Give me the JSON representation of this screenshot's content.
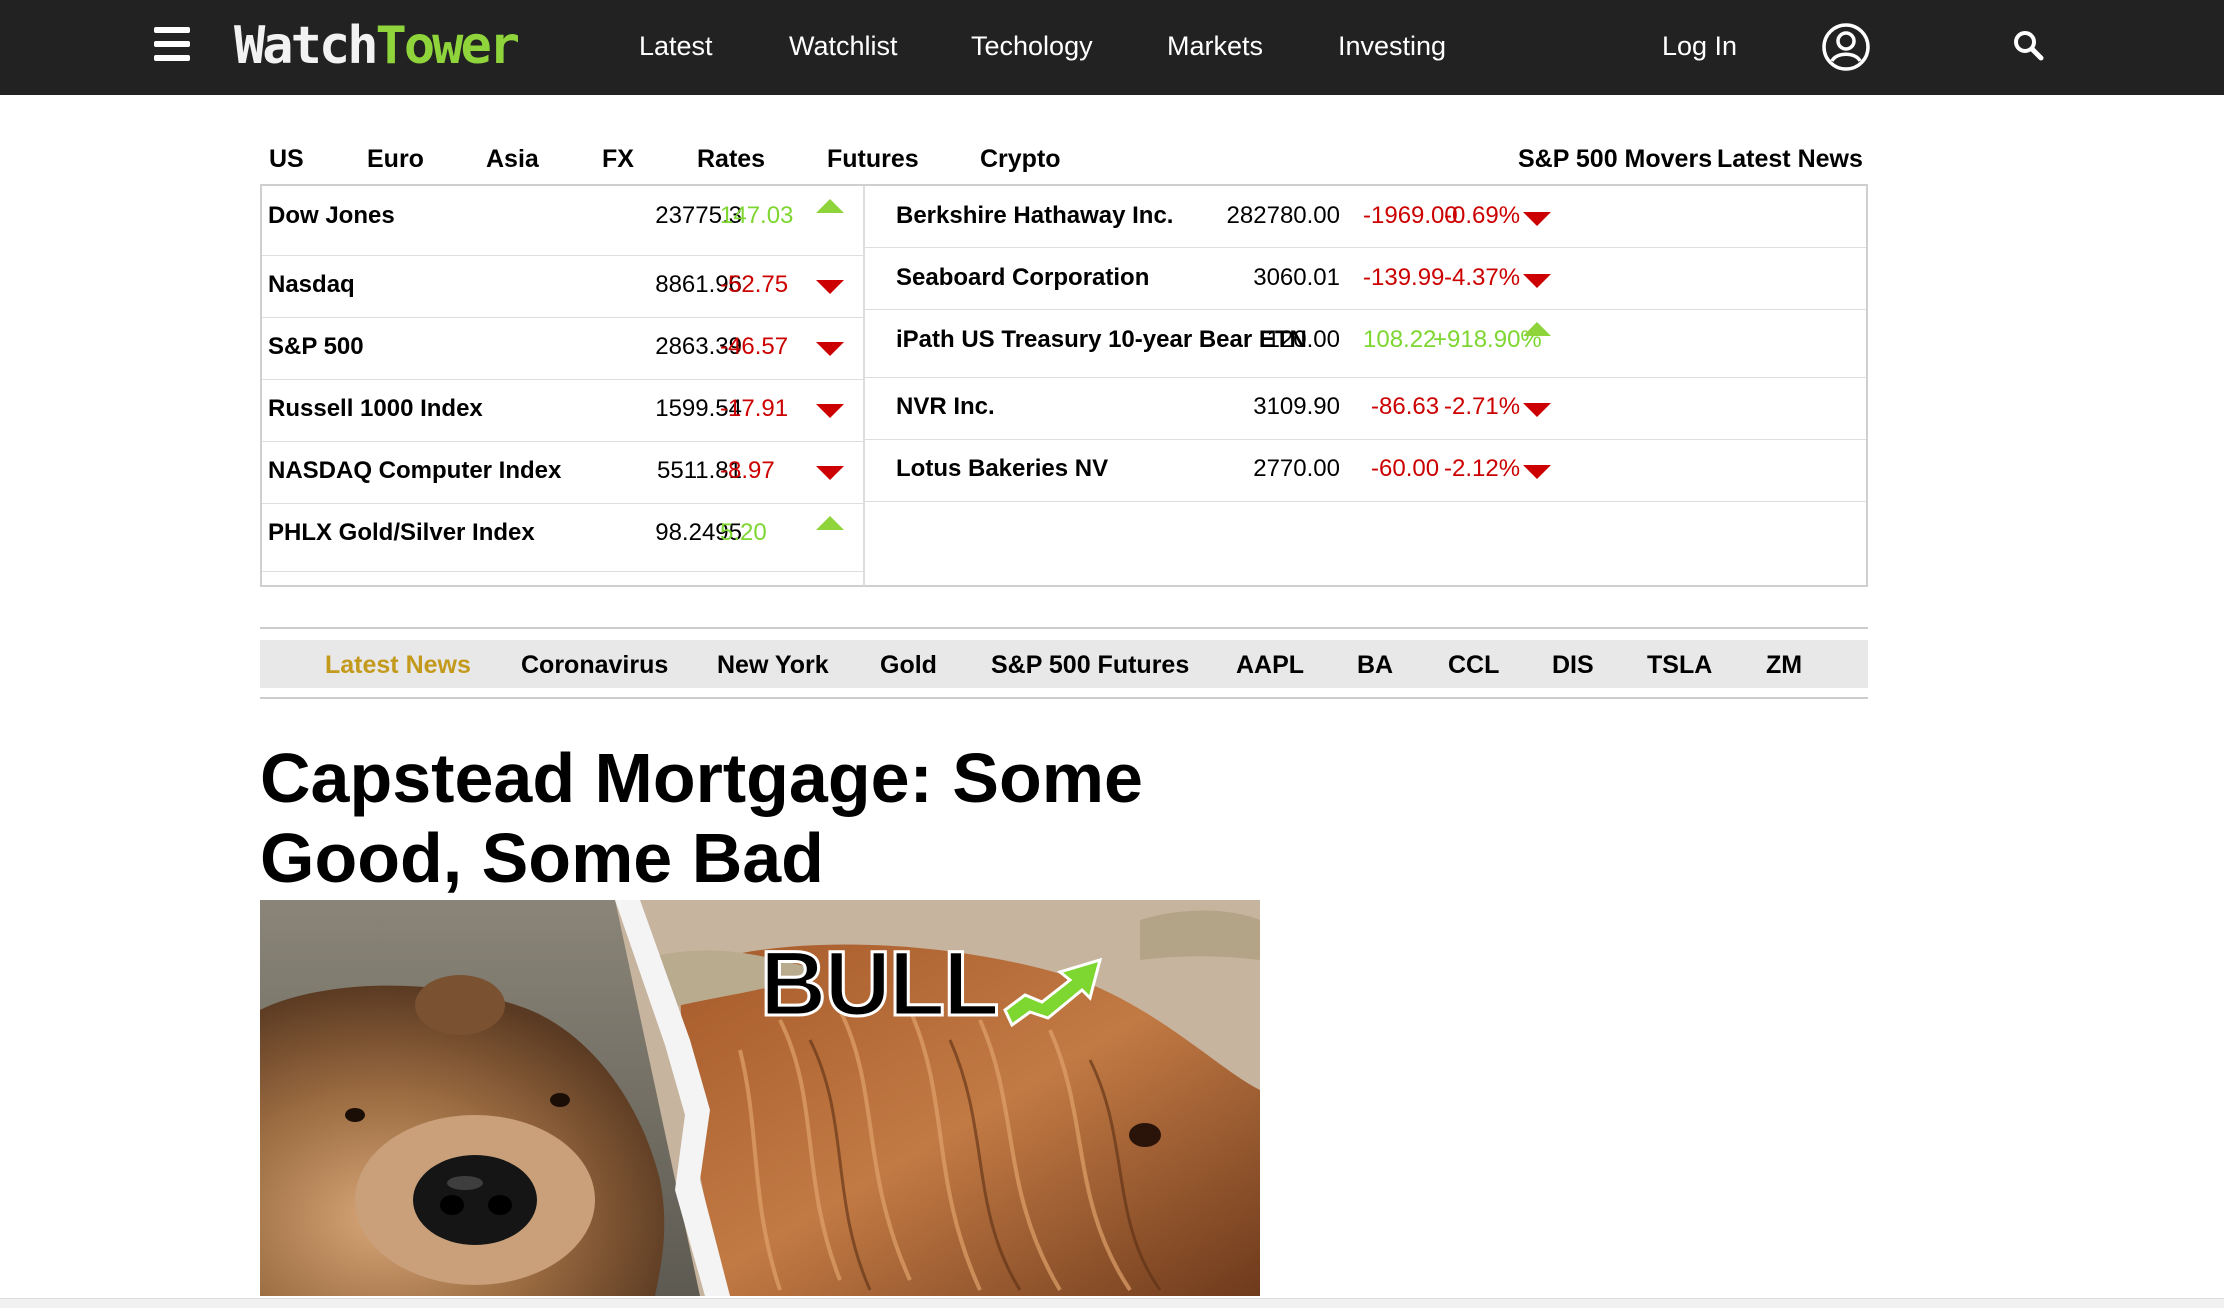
{
  "navbar": {
    "logo_part1": "Watch",
    "logo_part2": "Tower",
    "links": [
      "Latest",
      "Watchlist",
      "Techology",
      "Markets",
      "Investing"
    ],
    "login": "Log In",
    "colors": {
      "background": "#222222",
      "logo_accent": "#8ed43a"
    },
    "icons": [
      "menu-icon",
      "user-icon",
      "search-icon"
    ]
  },
  "market_tabs": {
    "left": [
      "US",
      "Euro",
      "Asia",
      "FX",
      "Rates",
      "Futures",
      "Crypto"
    ],
    "right": [
      "S&P 500 Movers",
      "Latest News"
    ]
  },
  "indices": [
    {
      "name": "Dow Jones",
      "value": "23775.3",
      "change": "147.03",
      "direction": "up"
    },
    {
      "name": "Nasdaq",
      "value": "8861.96",
      "change": "-52.75",
      "direction": "down"
    },
    {
      "name": "S&P 500",
      "value": "2863.39",
      "change": "-46.57",
      "direction": "down"
    },
    {
      "name": "Russell 1000 Index",
      "value": "1599.54",
      "change": "-17.91",
      "direction": "down"
    },
    {
      "name": "NASDAQ Computer Index",
      "value": "5511.81",
      "change": "-8.97",
      "direction": "down"
    },
    {
      "name": "PHLX Gold/Silver Index",
      "value": "98.2495",
      "change": "5.20",
      "direction": "up"
    }
  ],
  "movers": [
    {
      "name": "Berkshire Hathaway Inc.",
      "price": "282780.00",
      "change": "-1969.00",
      "percent": "-0.69%",
      "direction": "down"
    },
    {
      "name": "Seaboard Corporation",
      "price": "3060.01",
      "change": "-139.99",
      "percent": "-4.37%",
      "direction": "down"
    },
    {
      "name": "iPath US Treasury 10-year Bear ETN",
      "price": "120.00",
      "change": "108.22",
      "percent": "+918.90%",
      "direction": "up"
    },
    {
      "name": "NVR Inc.",
      "price": "3109.90",
      "change": "-86.63",
      "percent": "-2.71%",
      "direction": "down"
    },
    {
      "name": "Lotus Bakeries NV",
      "price": "2770.00",
      "change": "-60.00",
      "percent": "-2.12%",
      "direction": "down"
    }
  ],
  "colors": {
    "positive": "#7ed631",
    "negative": "#cc0000",
    "active_topic": "#c39a1c"
  },
  "topics": [
    "Latest News",
    "Coronavirus",
    "New York",
    "Gold",
    "S&P 500 Futures",
    "AAPL",
    "BA",
    "CCL",
    "DIS",
    "TSLA",
    "ZM"
  ],
  "active_topic": "Latest News",
  "article": {
    "headline": "Capstead Mortgage: Some Good, Some Bad",
    "image_text": "BULL"
  }
}
